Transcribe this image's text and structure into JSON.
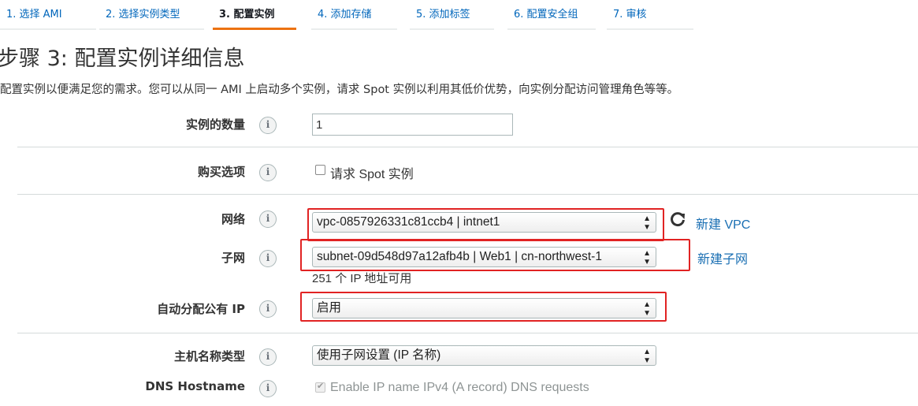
{
  "wizard": {
    "tabs": [
      {
        "label": "1. 选择 AMI",
        "active": false
      },
      {
        "label": "2. 选择实例类型",
        "active": false
      },
      {
        "label": "3. 配置实例",
        "active": true
      },
      {
        "label": "4. 添加存储",
        "active": false
      },
      {
        "label": "5. 添加标签",
        "active": false
      },
      {
        "label": "6. 配置安全组",
        "active": false
      },
      {
        "label": "7. 审核",
        "active": false
      }
    ]
  },
  "page": {
    "title": "步骤 3: 配置实例详细信息",
    "description": "配置实例以便满足您的需求。您可以从同一 AMI 上启动多个实例，请求 Spot 实例以利用其低价优势，向实例分配访问管理角色等等。"
  },
  "form": {
    "instance_count": {
      "label": "实例的数量",
      "value": "1"
    },
    "purchase_option": {
      "label": "购买选项",
      "checkbox_label": "请求 Spot 实例",
      "checked": false
    },
    "network": {
      "label": "网络",
      "selected": "vpc-0857926331c81ccb4 | intnet1",
      "link": "新建 VPC"
    },
    "subnet": {
      "label": "子网",
      "selected": "subnet-09d548d97a12afb4b | Web1 | cn-northwest-1",
      "link": "新建子网",
      "note": "251 个 IP 地址可用"
    },
    "auto_assign_ip": {
      "label": "自动分配公有 IP",
      "selected": "启用"
    },
    "hostname_type": {
      "label": "主机名称类型",
      "selected": "使用子网设置 (IP 名称)"
    },
    "dns_hostname": {
      "label": "DNS Hostname",
      "checkbox_label": "Enable IP name IPv4 (A record) DNS requests",
      "checked": true,
      "disabled": true
    }
  },
  "info_icon_glyph": "i",
  "colors": {
    "link": "#1a6fb3",
    "active_tab_underline": "#ec7211",
    "highlight": "#e12323"
  }
}
